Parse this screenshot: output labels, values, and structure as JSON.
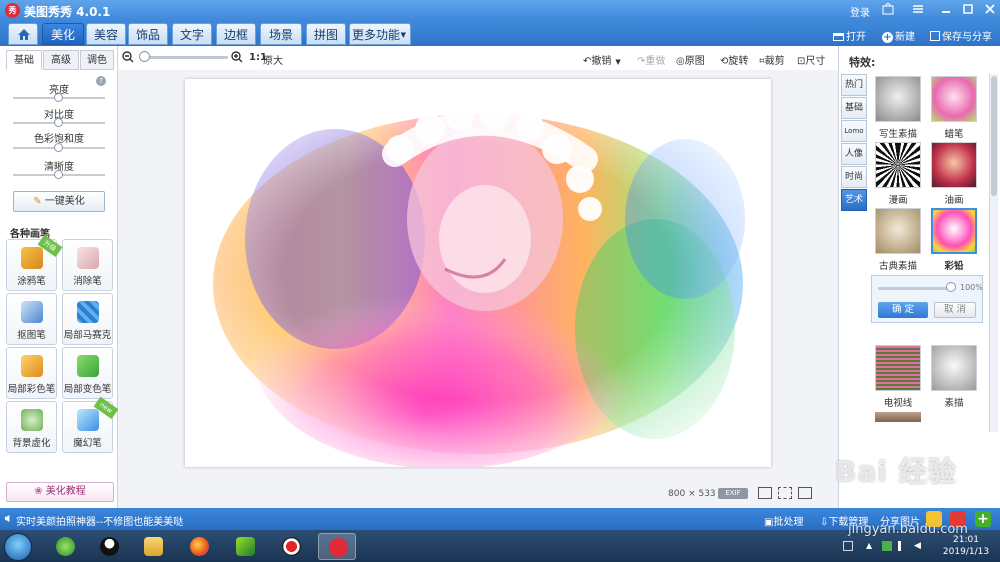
{
  "window": {
    "title": "美图秀秀 4.0.1",
    "logo_text": "秀",
    "login": "登录"
  },
  "nav": {
    "tabs": [
      "美化",
      "美容",
      "饰品",
      "文字",
      "边框",
      "场景",
      "拼图",
      "更多功能"
    ],
    "active_tab": "美化",
    "actions": {
      "open": "打开",
      "new": "新建",
      "save_share": "保存与分享"
    }
  },
  "toolbar": {
    "ratio_label": "1:1",
    "original_size": "原大",
    "undo": "撤销",
    "redo": "重做",
    "original": "原图",
    "rotate": "旋转",
    "crop": "裁剪",
    "resize": "尺寸"
  },
  "left_panel": {
    "tabs": [
      "基础",
      "高级",
      "调色"
    ],
    "active_tab": "基础",
    "sliders": [
      {
        "label": "亮度",
        "value": 0.5
      },
      {
        "label": "对比度",
        "value": 0.5
      },
      {
        "label": "色彩饱和度",
        "value": 0.5
      },
      {
        "label": "清晰度",
        "value": 0.5
      }
    ],
    "one_click": "一键美化",
    "pens_title": "各种画笔",
    "pens": [
      {
        "label": "涂鸦笔",
        "badge": "升级"
      },
      {
        "label": "消除笔",
        "badge": ""
      },
      {
        "label": "抠图笔",
        "badge": ""
      },
      {
        "label": "局部马赛克",
        "badge": ""
      },
      {
        "label": "局部彩色笔",
        "badge": ""
      },
      {
        "label": "局部变色笔",
        "badge": ""
      },
      {
        "label": "背景虚化",
        "badge": ""
      },
      {
        "label": "魔幻笔",
        "badge": "new"
      }
    ],
    "tutorial": "美化教程"
  },
  "canvas": {
    "image_width": "800",
    "times": "×",
    "image_height": "533",
    "exif": "EXIF"
  },
  "right_panel": {
    "title": "特效:",
    "categories": [
      "热门",
      "基础",
      "Lomo",
      "人像",
      "时尚",
      "艺术"
    ],
    "active_category": "艺术",
    "effects": [
      {
        "label": "写生素描"
      },
      {
        "label": "蜡笔"
      },
      {
        "label": "漫画"
      },
      {
        "label": "油画"
      },
      {
        "label": "古典素描"
      },
      {
        "label": "彩铅"
      },
      {
        "label": "电视线"
      },
      {
        "label": "素描"
      }
    ],
    "selected_effect": "彩铅",
    "intensity": {
      "value": 1.0,
      "text": "100%"
    },
    "confirm": "确 定",
    "cancel": "取 消"
  },
  "status_bar": {
    "message": "实时美颜拍照神器--不修图也能美美哒",
    "batch": "批处理",
    "downloads": "下载管理",
    "share": "分享图片"
  },
  "taskbar": {
    "time": "21:01",
    "date": "2019/1/13"
  },
  "watermark": {
    "main": "Bai 经验",
    "url": "jingyan.baidu.com"
  }
}
